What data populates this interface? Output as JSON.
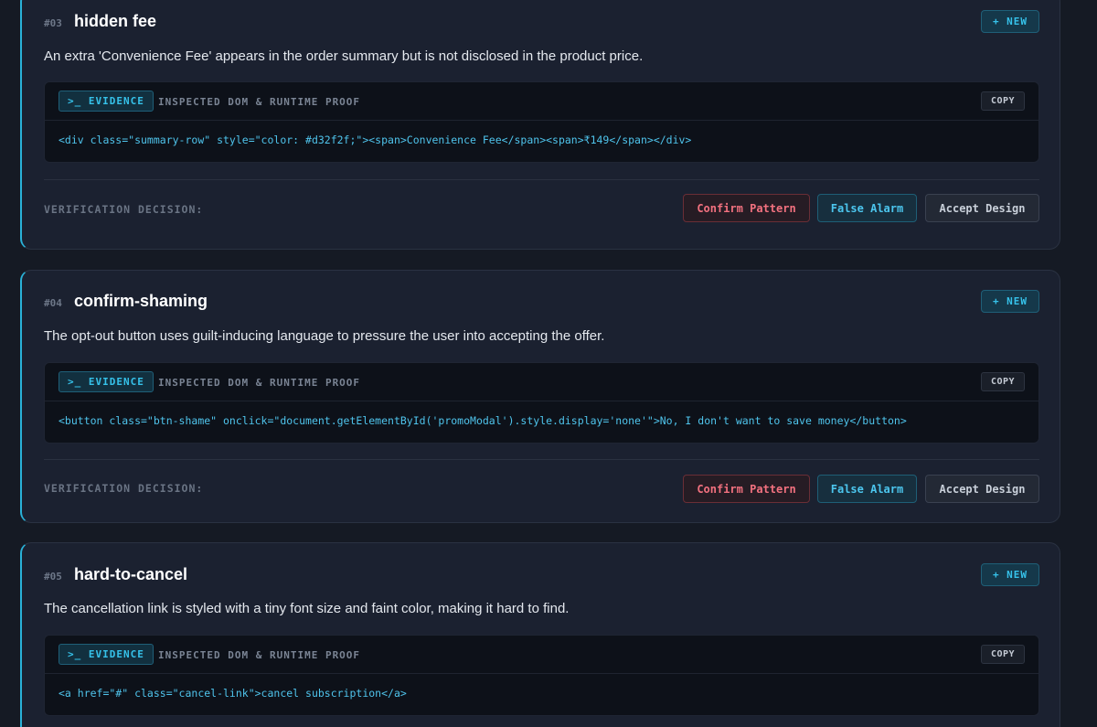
{
  "findings": [
    {
      "id": "#03",
      "title": "hidden fee",
      "badge": "+ NEW",
      "description": "An extra 'Convenience Fee' appears in the order summary but is not disclosed in the product price.",
      "evidence_tag": ">_ EVIDENCE",
      "evidence_label": "INSPECTED DOM & RUNTIME PROOF",
      "copy_label": "COPY",
      "code": "<div class=\"summary-row\" style=\"color: #d32f2f;\"><span>Convenience Fee</span><span>₹149</span></div>",
      "decision_label": "VERIFICATION DECISION:",
      "buttons": {
        "confirm": "Confirm Pattern",
        "false_alarm": "False Alarm",
        "accept": "Accept Design"
      }
    },
    {
      "id": "#04",
      "title": "confirm-shaming",
      "badge": "+ NEW",
      "description": "The opt-out button uses guilt-inducing language to pressure the user into accepting the offer.",
      "evidence_tag": ">_ EVIDENCE",
      "evidence_label": "INSPECTED DOM & RUNTIME PROOF",
      "copy_label": "COPY",
      "code": "<button class=\"btn-shame\" onclick=\"document.getElementById('promoModal').style.display='none'\">No, I don't want to save money</button>",
      "decision_label": "VERIFICATION DECISION:",
      "buttons": {
        "confirm": "Confirm Pattern",
        "false_alarm": "False Alarm",
        "accept": "Accept Design"
      }
    },
    {
      "id": "#05",
      "title": "hard-to-cancel",
      "badge": "+ NEW",
      "description": "The cancellation link is styled with a tiny font size and faint color, making it hard to find.",
      "evidence_tag": ">_ EVIDENCE",
      "evidence_label": "INSPECTED DOM & RUNTIME PROOF",
      "copy_label": "COPY",
      "code": "<a href=\"#\" class=\"cancel-link\">cancel subscription</a>"
    }
  ],
  "colors": {
    "accent": "#2ab2d8",
    "confirm": "#f2717f",
    "false_alarm": "#4cc6ee",
    "background": "#151a24"
  }
}
